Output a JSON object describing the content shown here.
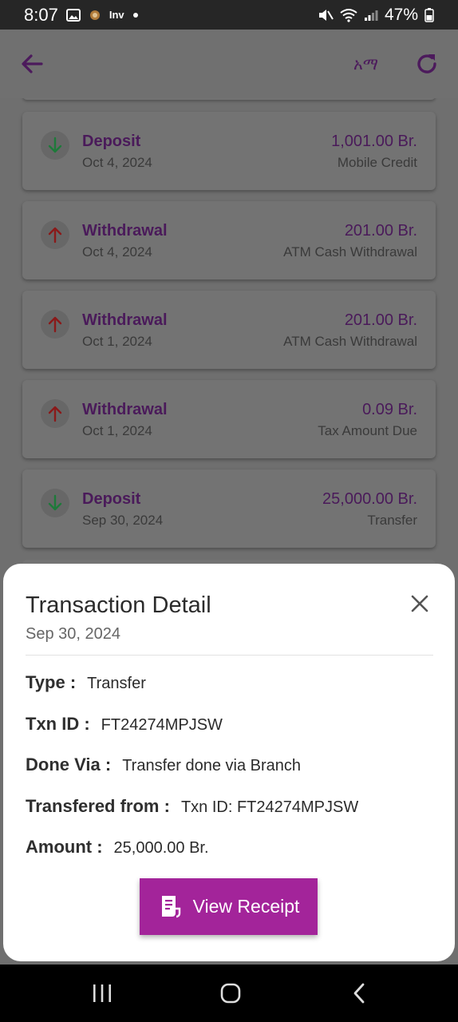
{
  "status_bar": {
    "time": "8:07",
    "notification_label": "Inv",
    "battery": "47%"
  },
  "app_bar": {
    "language_label": "አማ",
    "accent_color": "#4c1a5c"
  },
  "transactions": [
    {
      "type": "Deposit",
      "date": "Oct 4, 2024",
      "amount": "1,001.00 Br.",
      "description": "Mobile Credit",
      "direction": "down"
    },
    {
      "type": "Withdrawal",
      "date": "Oct 4, 2024",
      "amount": "201.00 Br.",
      "description": "ATM Cash Withdrawal",
      "direction": "up"
    },
    {
      "type": "Withdrawal",
      "date": "Oct 1, 2024",
      "amount": "201.00 Br.",
      "description": "ATM Cash Withdrawal",
      "direction": "up"
    },
    {
      "type": "Withdrawal",
      "date": "Oct 1, 2024",
      "amount": "0.09 Br.",
      "description": "Tax Amount Due",
      "direction": "up"
    },
    {
      "type": "Deposit",
      "date": "Sep 30, 2024",
      "amount": "25,000.00 Br.",
      "description": "Transfer",
      "direction": "down"
    }
  ],
  "detail": {
    "title": "Transaction Detail",
    "date": "Sep 30, 2024",
    "type_label": "Type :",
    "type_value": "Transfer",
    "txn_id_label": "Txn ID :",
    "txn_id_value": "FT24274MPJSW",
    "done_via_label": "Done Via :",
    "done_via_value": "Transfer done via Branch",
    "from_label": "Transfered from :",
    "from_value": "Txn ID: FT24274MPJSW",
    "amount_label": "Amount :",
    "amount_value": "25,000.00 Br.",
    "receipt_button": "View Receipt",
    "button_color": "#a3249a"
  }
}
